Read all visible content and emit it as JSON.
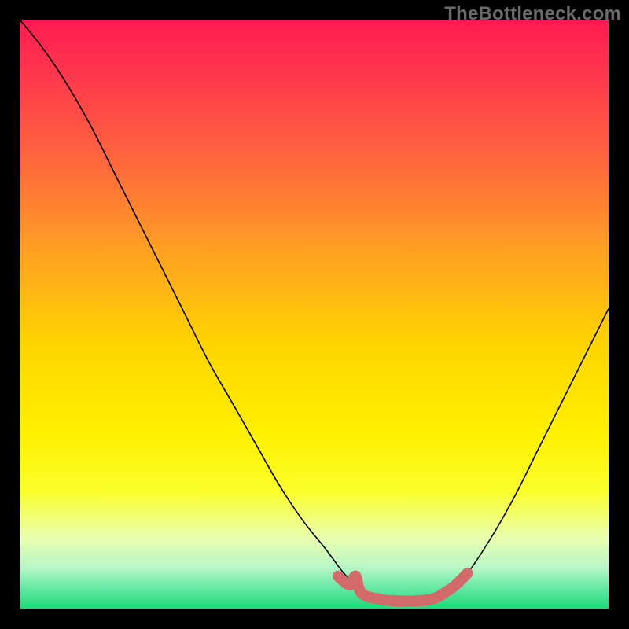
{
  "watermark": "TheBottleneck.com",
  "chart_data": {
    "type": "line",
    "title": "",
    "xlabel": "",
    "ylabel": "",
    "xlim": [
      0,
      100
    ],
    "ylim": [
      0,
      100
    ],
    "background_gradient_stops": [
      {
        "offset": 0.0,
        "color": "#ff1a52"
      },
      {
        "offset": 0.1,
        "color": "#ff3a4c"
      },
      {
        "offset": 0.25,
        "color": "#ff6a3c"
      },
      {
        "offset": 0.4,
        "color": "#ffa321"
      },
      {
        "offset": 0.55,
        "color": "#ffd400"
      },
      {
        "offset": 0.7,
        "color": "#fff000"
      },
      {
        "offset": 0.8,
        "color": "#fbff2a"
      },
      {
        "offset": 0.88,
        "color": "#eaffb0"
      },
      {
        "offset": 0.93,
        "color": "#b8f7c7"
      },
      {
        "offset": 0.97,
        "color": "#5ae6a0"
      },
      {
        "offset": 1.0,
        "color": "#23d877"
      }
    ],
    "series": [
      {
        "name": "bottleneck-curve",
        "stroke": "#000000",
        "stroke_width": 1.6,
        "points": [
          {
            "x": 0,
            "y": 100
          },
          {
            "x": 4,
            "y": 95
          },
          {
            "x": 8,
            "y": 89
          },
          {
            "x": 12,
            "y": 82
          },
          {
            "x": 16,
            "y": 74
          },
          {
            "x": 20,
            "y": 66
          },
          {
            "x": 24,
            "y": 58
          },
          {
            "x": 28,
            "y": 50
          },
          {
            "x": 32,
            "y": 42
          },
          {
            "x": 36,
            "y": 35
          },
          {
            "x": 40,
            "y": 28
          },
          {
            "x": 44,
            "y": 21
          },
          {
            "x": 48,
            "y": 15
          },
          {
            "x": 52,
            "y": 10
          },
          {
            "x": 55,
            "y": 6
          },
          {
            "x": 58,
            "y": 3
          },
          {
            "x": 61,
            "y": 1.5
          },
          {
            "x": 64,
            "y": 1
          },
          {
            "x": 67,
            "y": 1
          },
          {
            "x": 70,
            "y": 1.5
          },
          {
            "x": 73,
            "y": 3
          },
          {
            "x": 76,
            "y": 6
          },
          {
            "x": 80,
            "y": 12
          },
          {
            "x": 84,
            "y": 19
          },
          {
            "x": 88,
            "y": 27
          },
          {
            "x": 92,
            "y": 35
          },
          {
            "x": 96,
            "y": 43
          },
          {
            "x": 100,
            "y": 51
          }
        ]
      },
      {
        "name": "optimal-zone-marker",
        "stroke": "#d36a6a",
        "stroke_width": 14,
        "linecap": "round",
        "points": [
          {
            "x": 54,
            "y": 5.5
          },
          {
            "x": 56,
            "y": 4.0
          },
          {
            "x": 57,
            "y": 5.5
          },
          {
            "x": 58,
            "y": 2.6
          },
          {
            "x": 61,
            "y": 1.6
          },
          {
            "x": 64,
            "y": 1.3
          },
          {
            "x": 67,
            "y": 1.3
          },
          {
            "x": 70,
            "y": 1.6
          },
          {
            "x": 72,
            "y": 2.6
          },
          {
            "x": 74,
            "y": 4.0
          },
          {
            "x": 76,
            "y": 6.0
          }
        ]
      }
    ]
  }
}
